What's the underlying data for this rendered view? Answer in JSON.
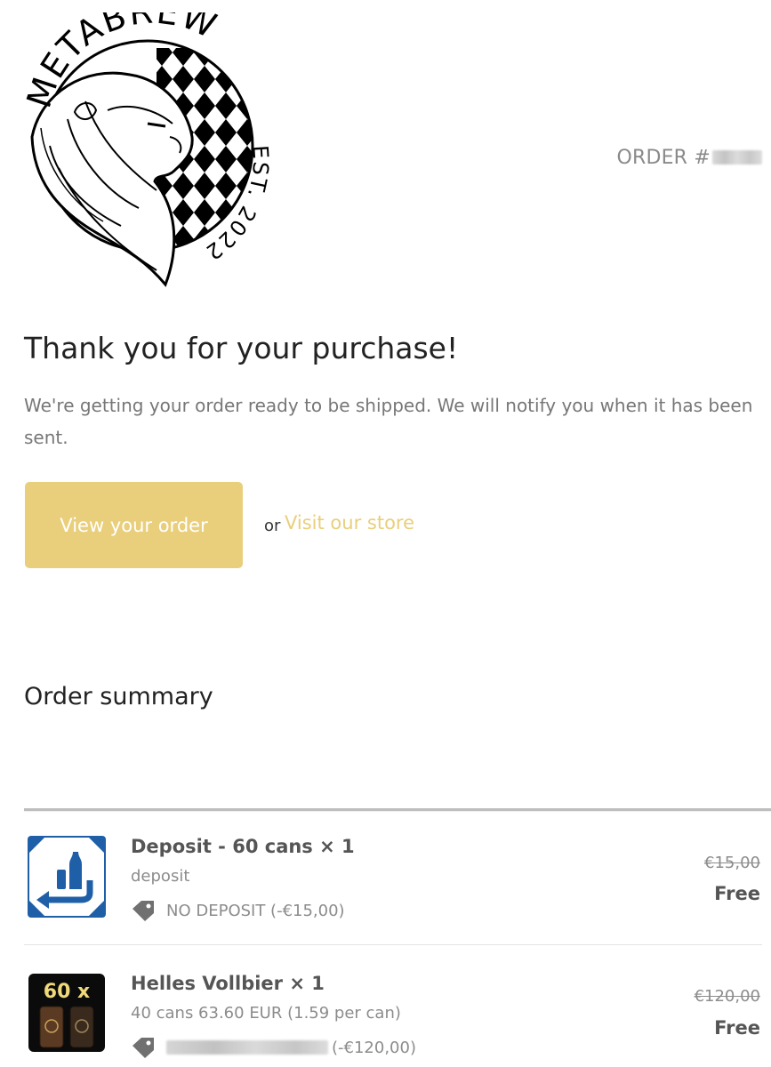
{
  "header": {
    "logo_text": "METABREW",
    "logo_est": "EST. 2022",
    "order_label": "ORDER #",
    "order_number_hidden": true
  },
  "confirmation": {
    "title": "Thank you for your purchase!",
    "message": "We're getting your order ready to be shipped. We will notify you when it has been sent.",
    "view_order_label": "View your order",
    "or_text": "or",
    "visit_store_label": "Visit our store"
  },
  "summary": {
    "title": "Order summary",
    "items": [
      {
        "name": "Deposit - 60 cans × 1",
        "variant": "deposit",
        "discount": "NO DEPOSIT (-€15,00)",
        "original_price": "€15,00",
        "final_price": "Free",
        "thumb_icon": "deposit-return-icon"
      },
      {
        "name": "Helles Vollbier × 1",
        "variant": "40 cans 63.60 EUR (1.59 per can)",
        "discount": "(-€120,00)",
        "discount_code_hidden": true,
        "original_price": "€120,00",
        "final_price": "Free",
        "thumb_label": "60 x",
        "thumb_icon": "beer-cans-image"
      }
    ]
  },
  "colors": {
    "accent": "#e9cf7b",
    "muted_text": "#8c8c8c",
    "heading_text": "#222222",
    "deposit_blue": "#1f5fa8"
  }
}
